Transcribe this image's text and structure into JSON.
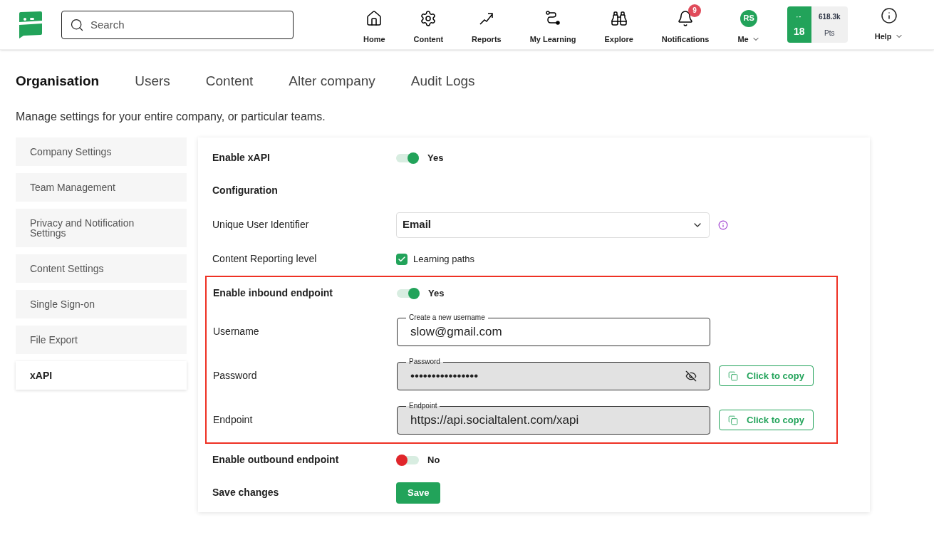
{
  "header": {
    "search": {
      "placeholder": "Search"
    },
    "nav": [
      {
        "kind": "home",
        "label": "Home"
      },
      {
        "kind": "gear",
        "label": "Content"
      },
      {
        "kind": "trend",
        "label": "Reports"
      },
      {
        "kind": "path",
        "label": "My Learning"
      },
      {
        "kind": "binoculars",
        "label": "Explore"
      },
      {
        "kind": "bell",
        "label": "Notifications",
        "badge": "9"
      },
      {
        "kind": "avatar",
        "label": "Me",
        "initials": "RS",
        "dropdown": true
      }
    ],
    "points": {
      "level": "18",
      "score": "618.3k",
      "unit": "Pts"
    },
    "help": {
      "label": "Help",
      "dropdown": true
    }
  },
  "tabs": [
    {
      "label": "Organisation",
      "selected": true
    },
    {
      "label": "Users",
      "selected": false
    },
    {
      "label": "Content",
      "selected": false
    },
    {
      "label": "Alter company",
      "selected": false
    },
    {
      "label": "Audit Logs",
      "selected": false
    }
  ],
  "subtitle": "Manage settings for your entire company, or particular teams.",
  "sidebar": {
    "items": [
      {
        "label": "Company Settings",
        "selected": false
      },
      {
        "label": "Team Management",
        "selected": false
      },
      {
        "label": "Privacy and Notification Settings",
        "selected": false
      },
      {
        "label": "Content Settings",
        "selected": false
      },
      {
        "label": "Single Sign-on",
        "selected": false
      },
      {
        "label": "File Export",
        "selected": false
      },
      {
        "label": "xAPI",
        "selected": true
      }
    ]
  },
  "rows": [
    {
      "kind": "toggle",
      "label": "Enable xAPI",
      "on": true,
      "text": "Yes"
    },
    {
      "kind": "heading",
      "label": "Configuration"
    },
    {
      "kind": "select",
      "label": "Unique User Identifier",
      "value": "Email"
    },
    {
      "kind": "checkbox",
      "label": "Content Reporting level",
      "checked": true,
      "text": "Learning paths"
    },
    {
      "kind": "highlight",
      "rows": [
        {
          "kind": "toggle",
          "label": "Enable inbound endpoint",
          "on": true,
          "text": "Yes"
        },
        {
          "kind": "field",
          "label": "Username",
          "field_label": "Create a new username",
          "value": "slow@gmail.com"
        },
        {
          "kind": "secret",
          "label": "Password",
          "field_label": "Password",
          "value": "••••••••••••••••",
          "copy": "Click to copy"
        },
        {
          "kind": "readonly",
          "label": "Endpoint",
          "field_label": "Endpoint",
          "value": "https://api.socialtalent.com/xapi",
          "copy": "Click to copy"
        }
      ]
    },
    {
      "kind": "toggle",
      "label": "Enable outbound endpoint",
      "on": false,
      "text": "No"
    },
    {
      "kind": "button",
      "label": "Save changes",
      "text": "Save"
    }
  ]
}
